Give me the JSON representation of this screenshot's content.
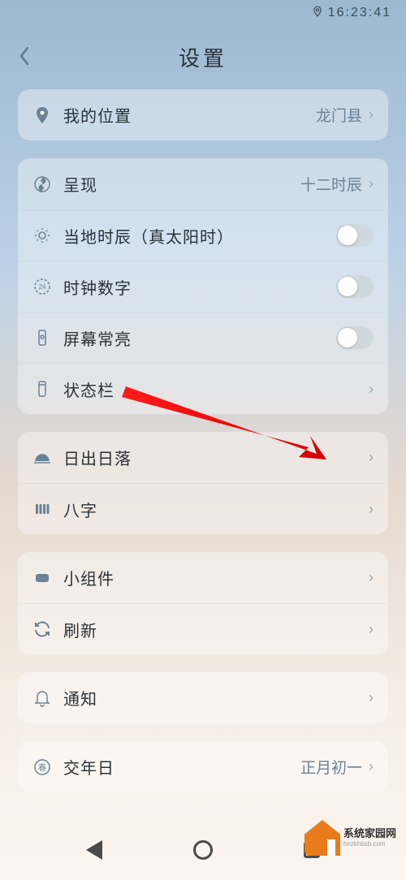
{
  "status": {
    "time": "16:23:41"
  },
  "header": {
    "title": "设置"
  },
  "groups": [
    {
      "rows": [
        {
          "icon": "location-pin-icon",
          "label": "我的位置",
          "value": "龙门县",
          "type": "link"
        }
      ]
    },
    {
      "rows": [
        {
          "icon": "yinyang-icon",
          "label": "呈现",
          "value": "十二时辰",
          "type": "link"
        },
        {
          "icon": "sun-icon",
          "label": "当地时辰（真太阳时）",
          "type": "toggle",
          "on": false
        },
        {
          "icon": "clock24-icon",
          "label": "时钟数字",
          "type": "toggle",
          "on": false
        },
        {
          "icon": "phone-bright-icon",
          "label": "屏幕常亮",
          "type": "toggle",
          "on": false
        },
        {
          "icon": "statusbar-icon",
          "label": "状态栏",
          "type": "link"
        }
      ]
    },
    {
      "rows": [
        {
          "icon": "sunrise-icon",
          "label": "日出日落",
          "type": "link"
        },
        {
          "icon": "bazi-icon",
          "label": "八字",
          "type": "link"
        }
      ]
    },
    {
      "rows": [
        {
          "icon": "widget-icon",
          "label": "小组件",
          "type": "link"
        },
        {
          "icon": "refresh-icon",
          "label": "刷新",
          "type": "link"
        }
      ]
    },
    {
      "rows": [
        {
          "icon": "bell-icon",
          "label": "通知",
          "type": "link"
        }
      ]
    },
    {
      "rows": [
        {
          "icon": "spring-icon",
          "label": "交年日",
          "value": "正月初一",
          "type": "link"
        }
      ]
    }
  ],
  "watermark": {
    "cn": "系统家园网",
    "en": "hnzkhbsb.com"
  }
}
